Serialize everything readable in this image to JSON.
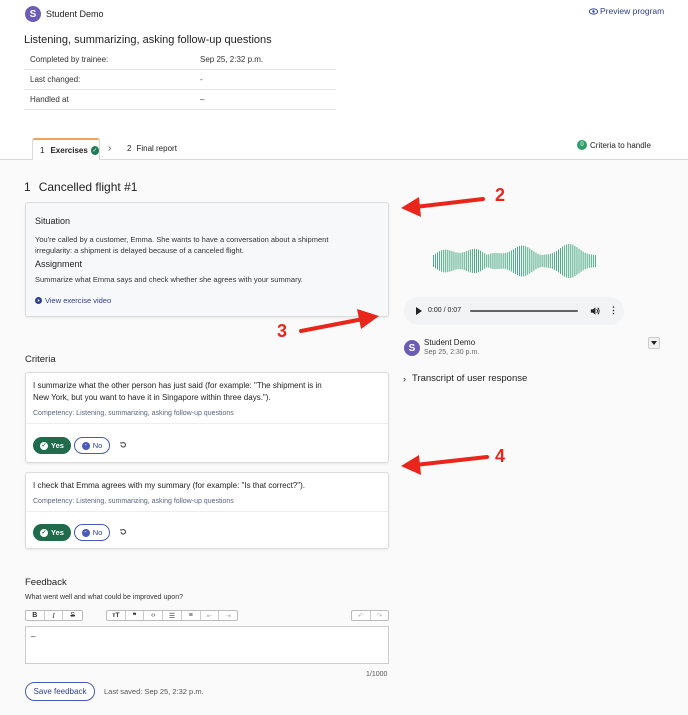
{
  "header": {
    "user_initial": "S",
    "user_name": "Student Demo",
    "preview_link": "Preview program",
    "title": "Listening, summarizing, asking follow-up questions",
    "info_rows": [
      {
        "label": "Completed by trainee:",
        "value": "Sep 25, 2:32 p.m."
      },
      {
        "label": "Last changed:",
        "value": "-"
      },
      {
        "label": "Handled at",
        "value": "–"
      }
    ]
  },
  "tabs": {
    "tab1_number": "1",
    "tab1_label": "Exercises",
    "separator": "›",
    "tab2_number": "2",
    "tab2_label": "Final report",
    "criteria_count": "0",
    "criteria_label": "Criteria to handle"
  },
  "exercise": {
    "number": "1",
    "title": "Cancelled flight #1",
    "situation_heading": "Situation",
    "situation_text_1": "You're called by a customer, Emma. She wants to have a conversation about a shipment",
    "situation_text_2": "irregularity: a shipment is delayed because of a canceled flight.",
    "assignment_heading": "Assignment",
    "assignment_text": "Summarize what Emma says and check whether she agrees with your summary.",
    "video_link": "View exercise video"
  },
  "criteria": {
    "heading": "Criteria",
    "items": [
      {
        "line1": "I summarize what the other person has just said (for example: \"The shipment is in",
        "line2": "New York, but you want to have it in Singapore within three days.\").",
        "competency": "Competency: Listening, summarizing, asking follow-up questions",
        "yes": "Yes",
        "no": "No"
      },
      {
        "line1": "I check that Emma agrees with my summary (for example: \"Is that correct?\").",
        "competency": "Competency: Listening, summarizing, asking follow-up questions",
        "yes": "Yes",
        "no": "No"
      }
    ]
  },
  "response": {
    "time": "0:00 / 0:07",
    "user_initial": "S",
    "user_name": "Student Demo",
    "timestamp": "Sep 25, 2:30 p.m.",
    "transcript_label": "Transcript of user response"
  },
  "feedback": {
    "heading": "Feedback",
    "prompt": "What went well and what could be improved upon?",
    "editor_value": "–",
    "counter": "1/1000",
    "save_label": "Save feedback",
    "last_saved": "Last saved: Sep 25, 2:32 p.m."
  },
  "annotations": {
    "label_2": "2",
    "label_3": "3",
    "label_4": "4",
    "arrow_color": "#e8261c"
  },
  "colors": {
    "primary": "#2f3e8f",
    "success": "#1f6b4c",
    "avatar": "#6d5bb8",
    "tab_accent": "#f0a35e"
  }
}
